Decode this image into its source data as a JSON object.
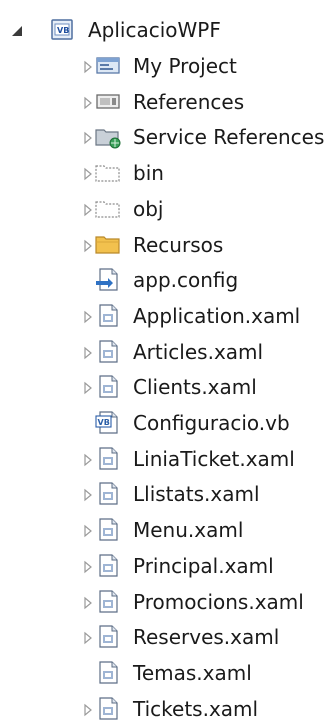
{
  "tree": {
    "root": {
      "label": "AplicacioWPF",
      "icon": "vb-project-icon",
      "expanded": true
    },
    "items": [
      {
        "label": "My Project",
        "icon": "my-project-icon",
        "expander": "collapsed"
      },
      {
        "label": "References",
        "icon": "references-icon",
        "expander": "collapsed"
      },
      {
        "label": "Service References",
        "icon": "service-references-icon",
        "expander": "collapsed"
      },
      {
        "label": "bin",
        "icon": "folder-outline-icon",
        "expander": "collapsed"
      },
      {
        "label": "obj",
        "icon": "folder-outline-icon",
        "expander": "collapsed"
      },
      {
        "label": "Recursos",
        "icon": "folder-icon",
        "expander": "collapsed"
      },
      {
        "label": "app.config",
        "icon": "config-file-icon",
        "expander": "none"
      },
      {
        "label": "Application.xaml",
        "icon": "xaml-file-icon",
        "expander": "collapsed"
      },
      {
        "label": "Articles.xaml",
        "icon": "xaml-file-icon",
        "expander": "collapsed"
      },
      {
        "label": "Clients.xaml",
        "icon": "xaml-file-icon",
        "expander": "collapsed"
      },
      {
        "label": "Configuracio.vb",
        "icon": "vb-file-icon",
        "expander": "none"
      },
      {
        "label": "LiniaTicket.xaml",
        "icon": "xaml-file-icon",
        "expander": "collapsed"
      },
      {
        "label": "Llistats.xaml",
        "icon": "xaml-file-icon",
        "expander": "collapsed"
      },
      {
        "label": "Menu.xaml",
        "icon": "xaml-file-icon",
        "expander": "collapsed"
      },
      {
        "label": "Principal.xaml",
        "icon": "xaml-file-icon",
        "expander": "collapsed"
      },
      {
        "label": "Promocions.xaml",
        "icon": "xaml-file-icon",
        "expander": "collapsed"
      },
      {
        "label": "Reserves.xaml",
        "icon": "xaml-file-icon",
        "expander": "collapsed"
      },
      {
        "label": "Temas.xaml",
        "icon": "xaml-file-icon",
        "expander": "none"
      },
      {
        "label": "Tickets.xaml",
        "icon": "xaml-file-icon",
        "expander": "collapsed"
      }
    ]
  }
}
